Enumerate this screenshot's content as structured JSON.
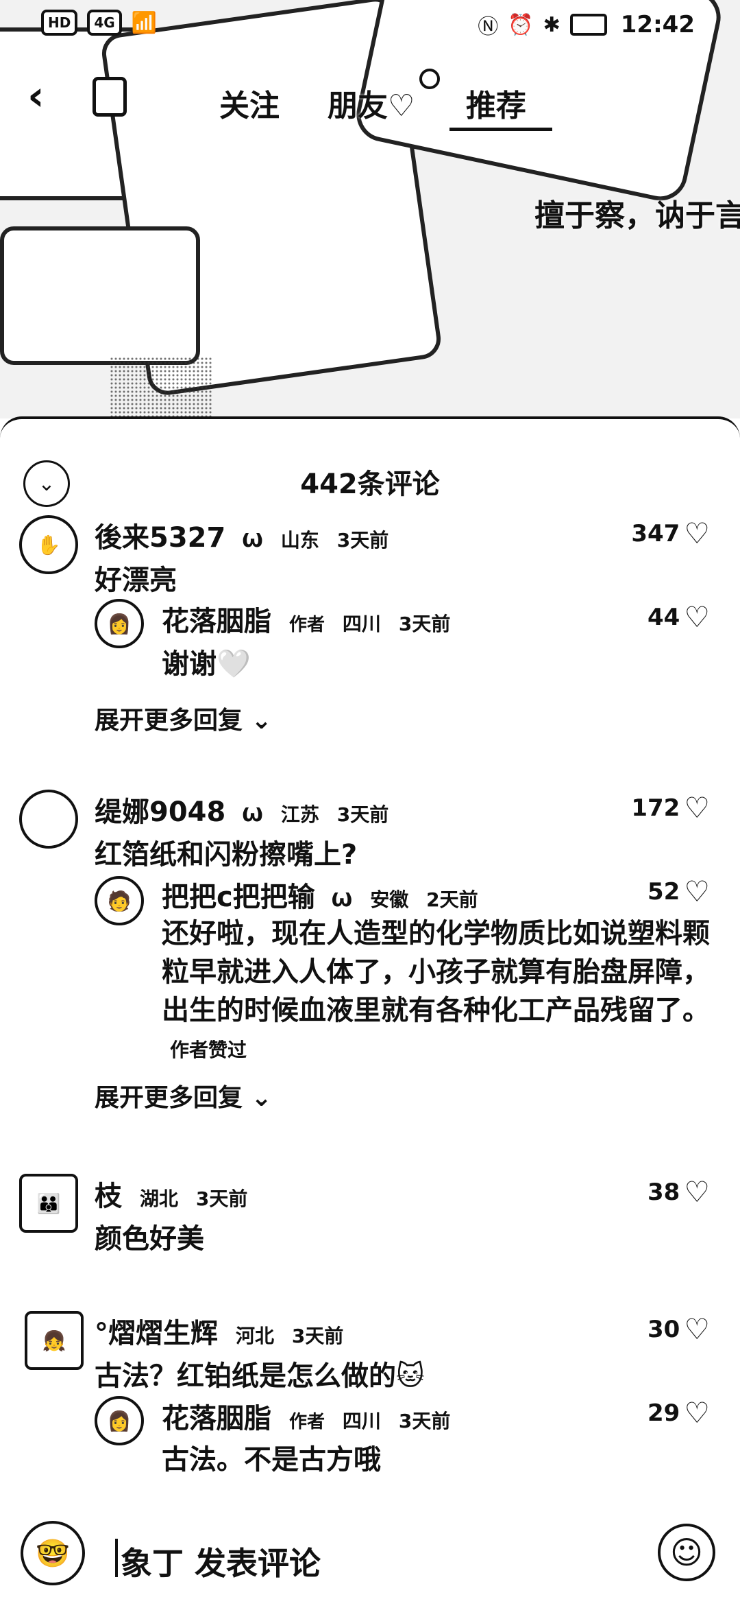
{
  "status_bar": {
    "left_badge": "HD",
    "network": "4G",
    "time": "12:42"
  },
  "nav": {
    "tabs": [
      "关注",
      "朋友♡",
      "推荐"
    ]
  },
  "video": {
    "overlay_text": "擅于察，讷于言"
  },
  "sheet": {
    "title": "442条评论"
  },
  "comments": [
    {
      "user": "後来5327",
      "region": "山东",
      "time": "3天前",
      "text": "好漂亮",
      "likes": "347",
      "reply": {
        "user": "花落胭脂",
        "tag": "作者",
        "region": "四川",
        "time": "3天前",
        "text": "谢谢🤍",
        "likes": "44"
      },
      "more_label": "展开更多回复 ⌄"
    },
    {
      "user": "缇娜9048",
      "region": "江苏",
      "time": "3天前",
      "text": "红箔纸和闪粉擦嘴上?",
      "likes": "172",
      "reply": {
        "user": "把把c把把输",
        "region": "安徽",
        "time": "2天前",
        "text": "还好啦，现在人造型的化学物质比如说塑料颗粒早就进入人体了，小孩子就算有胎盘屏障，出生的时候血液里就有各种化工产品残留了。",
        "likes": "52",
        "author_liked": "作者赞过"
      },
      "more_label": "展开更多回复 ⌄"
    },
    {
      "user": "枝",
      "region": "湖北",
      "time": "3天前",
      "text": "颜色好美",
      "likes": "38"
    },
    {
      "user": "°熠熠生辉",
      "region": "河北",
      "time": "3天前",
      "text": "古法？红铂纸是怎么做的🐱",
      "likes": "30",
      "reply": {
        "user": "花落胭脂",
        "tag": "作者",
        "region": "四川",
        "time": "3天前",
        "text": "古法。不是古方哦",
        "likes": "29"
      }
    }
  ],
  "input": {
    "placeholder": "象丁 发表评论"
  },
  "icons": {
    "back": "chevron-left-icon",
    "heart": "heart-outline-icon",
    "emoji": "smile-icon",
    "collapse": "chevron-down-icon"
  }
}
